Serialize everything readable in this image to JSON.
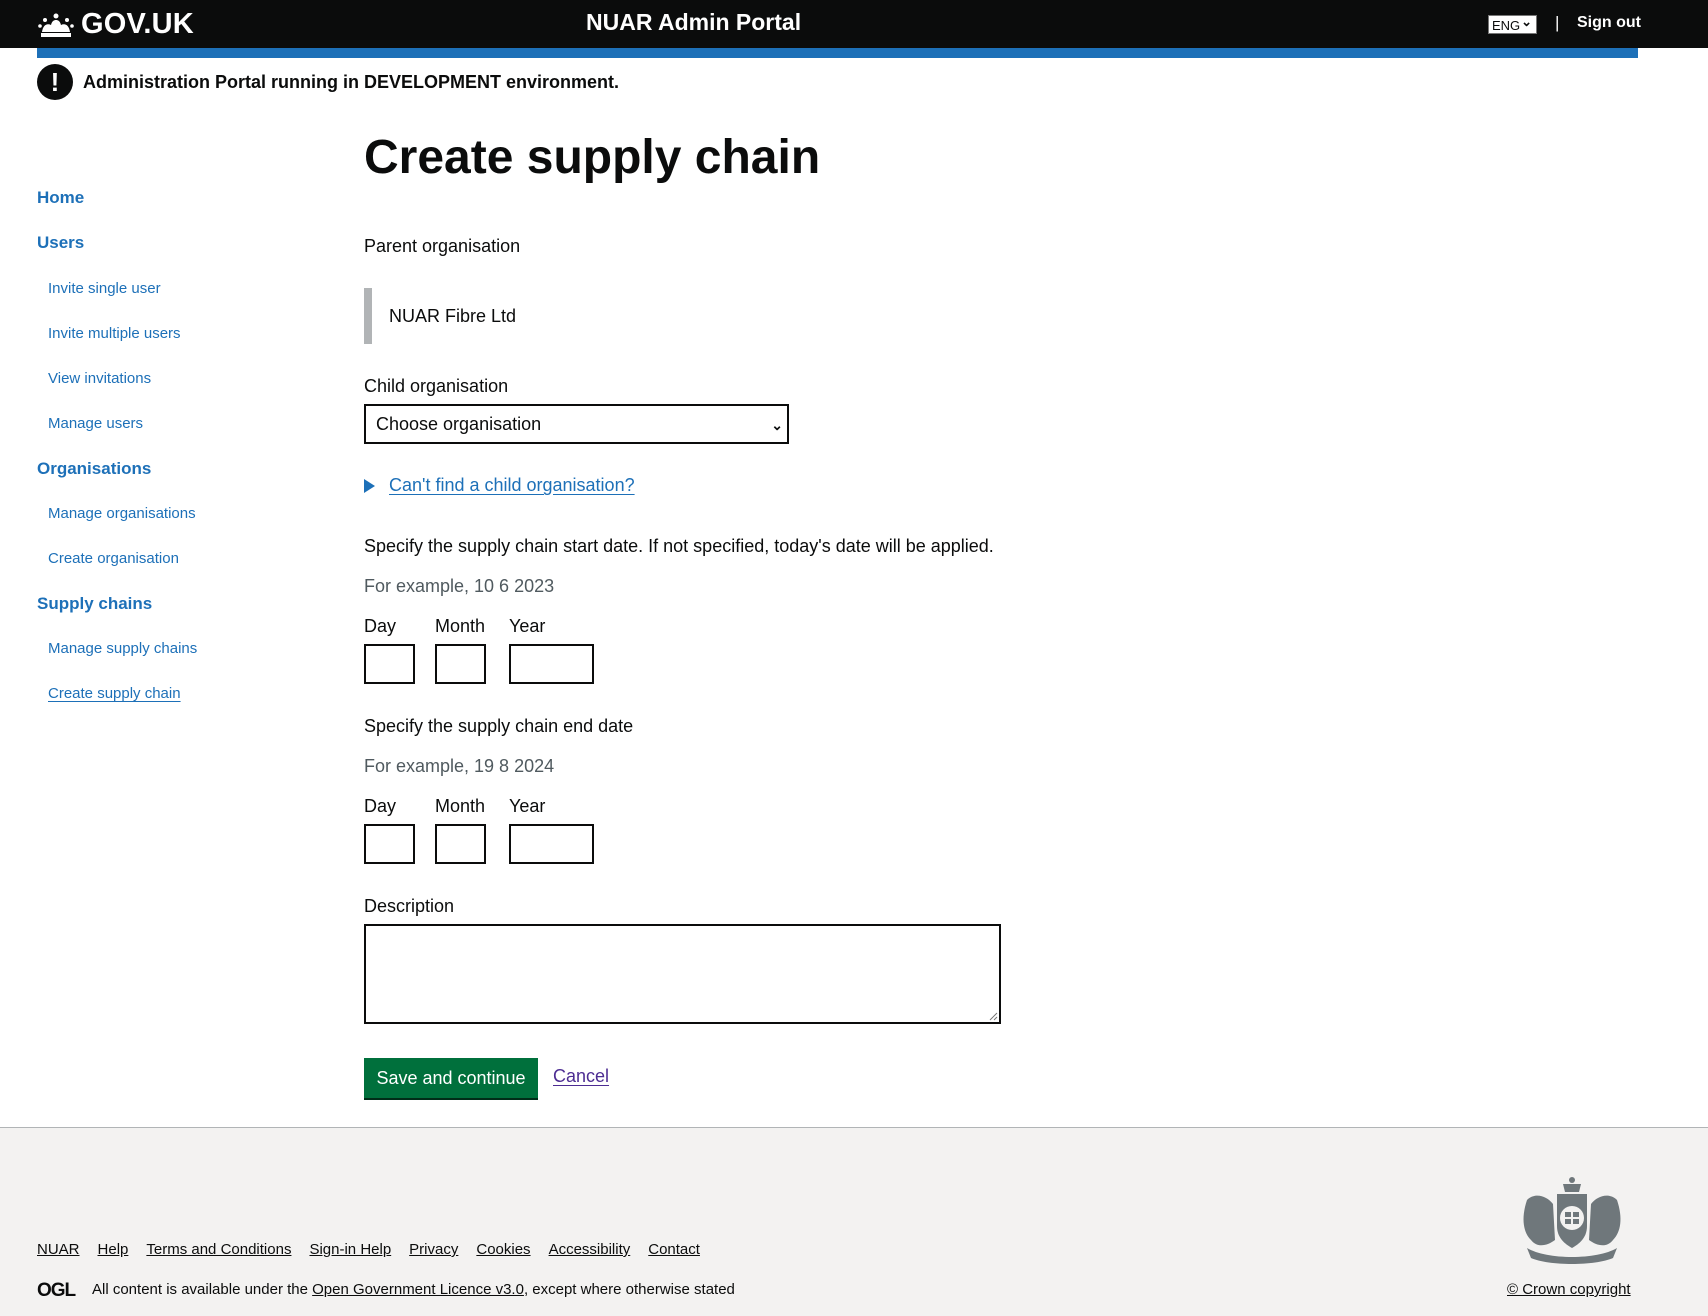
{
  "header": {
    "logo_text": "GOV.UK",
    "service_name": "NUAR Admin Portal",
    "language": "ENG",
    "separator": "|",
    "sign_out": "Sign out"
  },
  "warning": {
    "icon": "!",
    "text": "Administration Portal running in DEVELOPMENT environment."
  },
  "sidebar": {
    "items": [
      {
        "label": "Home",
        "level": "top"
      },
      {
        "label": "Users",
        "level": "top"
      },
      {
        "label": "Invite single user",
        "level": "sub"
      },
      {
        "label": "Invite multiple users",
        "level": "sub"
      },
      {
        "label": "View invitations",
        "level": "sub"
      },
      {
        "label": "Manage users",
        "level": "sub"
      },
      {
        "label": "Organisations",
        "level": "top"
      },
      {
        "label": "Manage organisations",
        "level": "sub"
      },
      {
        "label": "Create organisation",
        "level": "sub"
      },
      {
        "label": "Supply chains",
        "level": "top"
      },
      {
        "label": "Manage supply chains",
        "level": "sub"
      },
      {
        "label": "Create supply chain",
        "level": "sub",
        "current": true
      }
    ]
  },
  "form": {
    "title": "Create supply chain",
    "parent_label": "Parent organisation",
    "parent_value": "NUAR Fibre Ltd",
    "child_label": "Child organisation",
    "child_select": "Choose organisation",
    "details_link": "Can't find a child organisation?",
    "start_label": "Specify the supply chain start date. If not specified, today's date will be applied.",
    "start_hint": "For example, 10 6 2023",
    "end_label": "Specify the supply chain end date",
    "end_hint": "For example, 19 8 2024",
    "day": "Day",
    "month": "Month",
    "year": "Year",
    "description_label": "Description",
    "save_button": "Save and continue",
    "cancel_link": "Cancel"
  },
  "footer": {
    "links": [
      "NUAR",
      "Help",
      "Terms and Conditions",
      "Sign-in Help",
      "Privacy",
      "Cookies",
      "Accessibility",
      "Contact"
    ],
    "ogl": "OGL",
    "licence_prefix": "All content is available under the ",
    "licence_link": "Open Government Licence v3.0",
    "licence_suffix": ", except where otherwise stated",
    "copyright": "© Crown copyright"
  },
  "colors": {
    "header_bg": "#0b0c0c",
    "brand_blue": "#1d70b8",
    "button_green": "#00703c",
    "footer_bg": "#f3f2f1"
  }
}
